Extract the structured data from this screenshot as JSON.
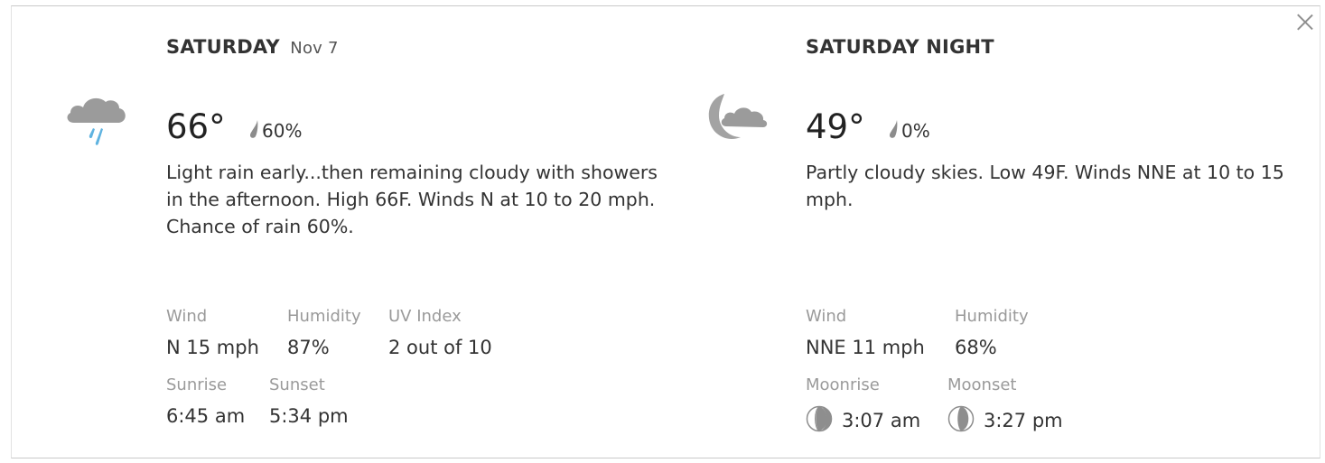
{
  "day": {
    "title": "SATURDAY",
    "date": "Nov 7",
    "icon": "rain-cloud-icon",
    "temp": "66°",
    "precip": "60%",
    "description": "Light rain early...then remaining cloudy with showers in the afternoon. High 66F. Winds N at 10 to 20 mph. Chance of rain 60%.",
    "details": {
      "wind": {
        "label": "Wind",
        "value": "N 15 mph"
      },
      "humidity": {
        "label": "Humidity",
        "value": "87%"
      },
      "uv": {
        "label": "UV Index",
        "value": "2 out of 10"
      },
      "sunrise": {
        "label": "Sunrise",
        "value": "6:45 am"
      },
      "sunset": {
        "label": "Sunset",
        "value": "5:34 pm"
      }
    }
  },
  "night": {
    "title": "SATURDAY NIGHT",
    "icon": "partly-cloudy-night-icon",
    "temp": "49°",
    "precip": "0%",
    "description": "Partly cloudy skies. Low 49F. Winds NNE at 10 to 15 mph.",
    "details": {
      "wind": {
        "label": "Wind",
        "value": "NNE 11 mph"
      },
      "humidity": {
        "label": "Humidity",
        "value": "68%"
      },
      "moonrise": {
        "label": "Moonrise",
        "value": "3:07 am"
      },
      "moonset": {
        "label": "Moonset",
        "value": "3:27 pm"
      }
    }
  },
  "colors": {
    "cloud": "#9b9b9b",
    "rain": "#5fb3e0",
    "label": "#9a9a9a",
    "text": "#333333"
  }
}
